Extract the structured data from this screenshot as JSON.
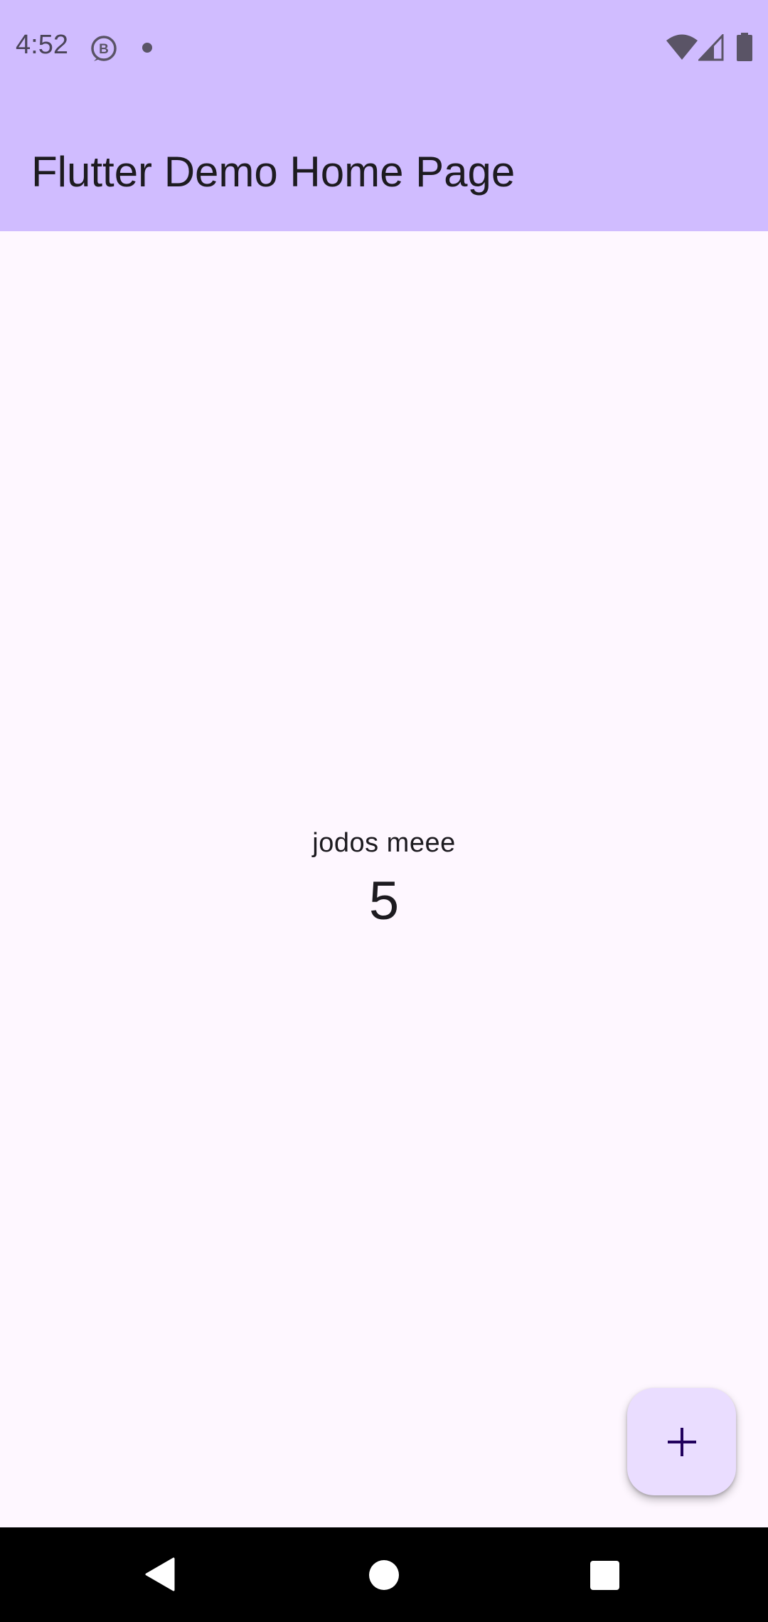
{
  "status_bar": {
    "time": "4:52",
    "icons": [
      "b-badge-icon",
      "notification-dot-icon",
      "wifi-icon",
      "cell-signal-icon",
      "battery-icon"
    ]
  },
  "app_bar": {
    "title": "Flutter Demo Home Page",
    "color": "#d0bcff"
  },
  "main": {
    "caption": "jodos meee",
    "counter": "5"
  },
  "fab": {
    "icon": "add-icon",
    "color": "#eaddff"
  },
  "nav_bar": {
    "icons": [
      "back-icon",
      "home-icon",
      "recents-icon"
    ]
  }
}
